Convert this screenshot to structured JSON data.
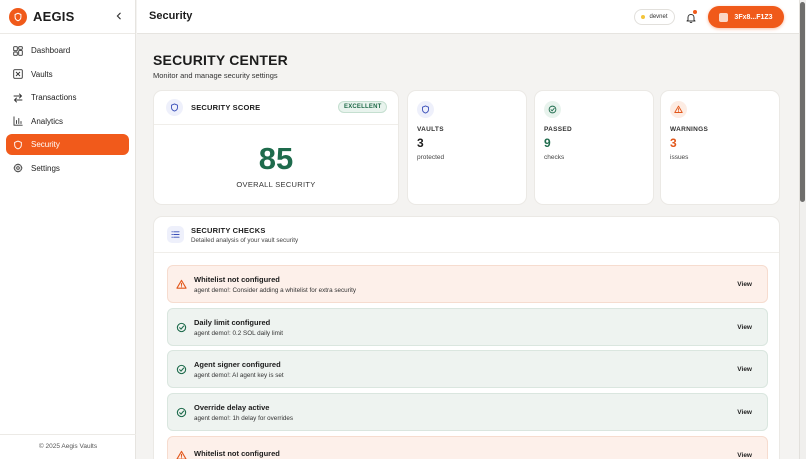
{
  "app": {
    "name": "AEGIS",
    "footer": "© 2025 Aegis Vaults"
  },
  "sidebar": {
    "items": [
      {
        "label": "Dashboard",
        "icon": "grid-icon",
        "active": false
      },
      {
        "label": "Vaults",
        "icon": "vault-icon",
        "active": false
      },
      {
        "label": "Transactions",
        "icon": "arrows-icon",
        "active": false
      },
      {
        "label": "Analytics",
        "icon": "chart-icon",
        "active": false
      },
      {
        "label": "Security",
        "icon": "shield-icon",
        "active": true
      },
      {
        "label": "Settings",
        "icon": "gear-icon",
        "active": false
      }
    ]
  },
  "header": {
    "title": "Security",
    "network": "devnet",
    "wallet": "3Fx8...F1Z3"
  },
  "main": {
    "heading": "SECURITY CENTER",
    "subheading": "Monitor and manage security settings",
    "score": {
      "title": "SECURITY SCORE",
      "badge": "EXCELLENT",
      "value": "85",
      "label": "OVERALL SECURITY"
    },
    "stats": [
      {
        "label": "VAULTS",
        "value": "3",
        "unit": "protected",
        "color": "#1c1c1c",
        "icon": "shield-icon"
      },
      {
        "label": "PASSED",
        "value": "9",
        "unit": "checks",
        "color": "#1e6b4c",
        "icon": "check-circle-icon"
      },
      {
        "label": "WARNINGS",
        "value": "3",
        "unit": "issues",
        "color": "#e2571b",
        "icon": "warning-icon"
      }
    ],
    "checks": {
      "title": "SECURITY CHECKS",
      "subtitle": "Detailed analysis of your vault security",
      "view_label": "View",
      "rows": [
        {
          "status": "warn",
          "title": "Whitelist not configured",
          "desc": "agent demo!: Consider adding a whitelist for extra security"
        },
        {
          "status": "ok",
          "title": "Daily limit configured",
          "desc": "agent demo!: 0.2 SOL daily limit"
        },
        {
          "status": "ok",
          "title": "Agent signer configured",
          "desc": "agent demo!: AI agent key is set"
        },
        {
          "status": "ok",
          "title": "Override delay active",
          "desc": "agent demo!: 1h delay for overrides"
        },
        {
          "status": "warn",
          "title": "Whitelist not configured",
          "desc": ""
        }
      ]
    }
  },
  "colors": {
    "accent": "#f05a1a",
    "success": "#1e6b4c",
    "warning": "#e2571b"
  }
}
